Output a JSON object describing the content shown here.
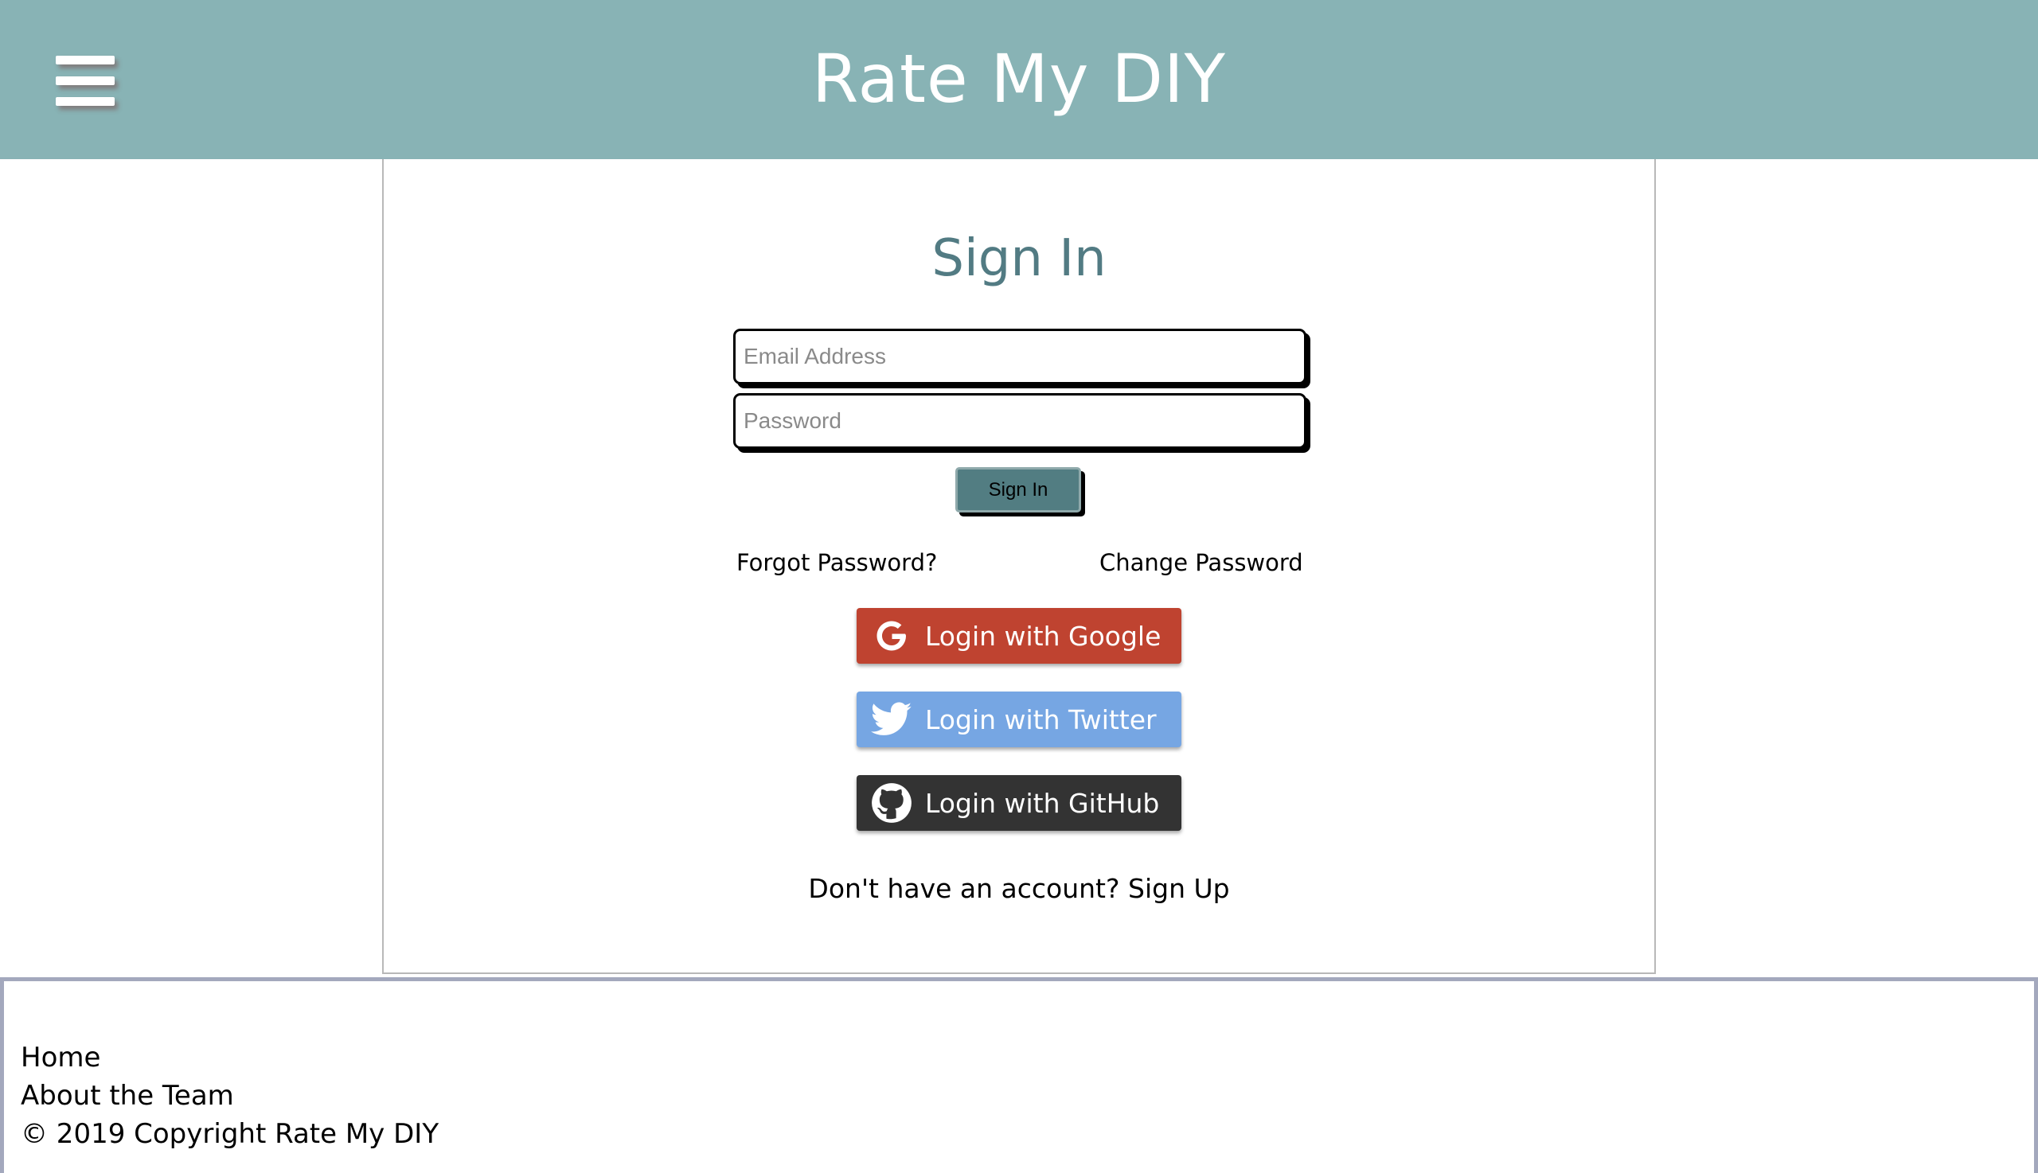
{
  "header": {
    "title": "Rate My DIY",
    "menu_icon": "hamburger-menu-icon",
    "background_color": "#88b3b5"
  },
  "signin": {
    "heading": "Sign In",
    "email_placeholder": "Email Address",
    "email_value": "",
    "password_placeholder": "Password",
    "password_value": "",
    "submit_label": "Sign In",
    "forgot_label": "Forgot Password?",
    "change_label": "Change Password"
  },
  "social": {
    "google": {
      "label": "Login with Google",
      "icon": "google-icon",
      "color": "#bf4330"
    },
    "twitter": {
      "label": "Login with Twitter",
      "icon": "twitter-icon",
      "color": "#76a6e3"
    },
    "github": {
      "label": "Login with GitHub",
      "icon": "github-icon",
      "color": "#333333"
    }
  },
  "account": {
    "prompt": "Don't have an account? ",
    "signup_label": "Sign Up"
  },
  "footer": {
    "home": "Home",
    "about": "About the Team",
    "copyright": "© 2019 Copyright Rate My DIY"
  }
}
